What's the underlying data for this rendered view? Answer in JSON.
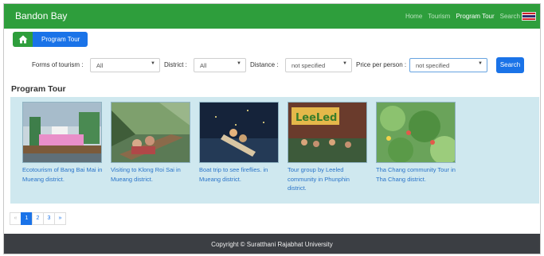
{
  "colors": {
    "nav_bg": "#2e9e3c",
    "primary": "#1a73e8",
    "card_area_bg": "#cfe8ef",
    "footer_bg": "#3b3e43",
    "link": "#2a74c9"
  },
  "nav": {
    "brand": "Bandon Bay",
    "links": [
      {
        "label": "Home",
        "active": false
      },
      {
        "label": "Tourism",
        "active": false
      },
      {
        "label": "Program Tour",
        "active": true
      },
      {
        "label": "Search",
        "active": false
      }
    ],
    "flag_icon": "thailand-flag-icon"
  },
  "breadcrumb": {
    "home_icon": "home-icon",
    "label": "Program Tour"
  },
  "filters": {
    "forms_label": "Forms of tourism :",
    "forms_value": "All",
    "district_label": "District :",
    "district_value": "All",
    "distance_label": "Distance :",
    "distance_value": "not specified",
    "price_label": "Price per person :",
    "price_value": "not specified",
    "search_label": "Search"
  },
  "section_title": "Program Tour",
  "cards": [
    {
      "caption": "Ecotourism of Bang Bai Mai in Mueang district."
    },
    {
      "caption": "Visiting to Klong Roi Sai in Mueang district."
    },
    {
      "caption": "Boat trip to see fireflies. in Mueang district."
    },
    {
      "caption": "Tour group by Leeled community in Phunphin district."
    },
    {
      "caption": "Tha Chang community Tour in Tha Chang district."
    }
  ],
  "thumb_texts": {
    "card4": "LeeLed"
  },
  "pagination": {
    "prev": "«",
    "pages": [
      "1",
      "2",
      "3"
    ],
    "active_page": "1",
    "next": "»"
  },
  "footer": {
    "copyright": "Copyright © Suratthani Rajabhat University"
  }
}
